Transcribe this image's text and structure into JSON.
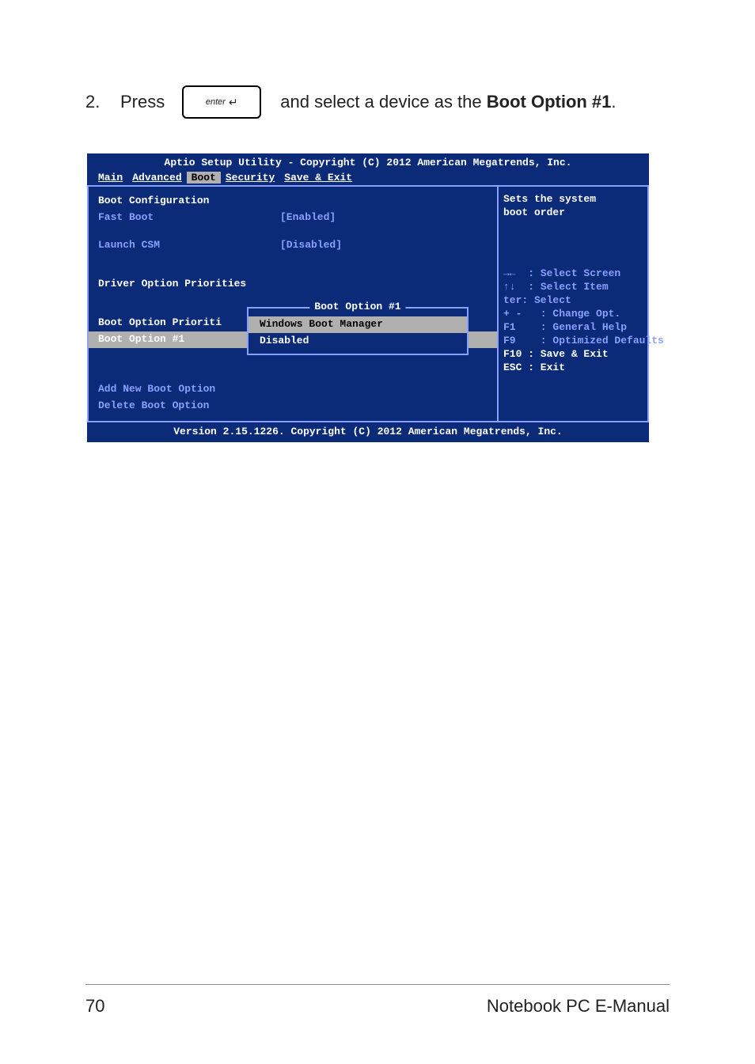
{
  "instruction": {
    "step": "2.",
    "prefix": "Press",
    "key_label": "enter",
    "suffix": " and select a device as the ",
    "bold": "Boot Option #1",
    "period": "."
  },
  "bios": {
    "header": "Aptio Setup Utility - Copyright (C) 2012 American Megatrends, Inc.",
    "tabs": [
      "Main",
      "Advanced",
      "Boot",
      "Security",
      "Save & Exit"
    ],
    "active_tab": "Boot",
    "left": {
      "config_title": "Boot Configuration",
      "fast_boot_label": "Fast Boot",
      "fast_boot_value": "[Enabled]",
      "launch_csm_label": "Launch CSM",
      "launch_csm_value": "[Disabled]",
      "driver_priorities": "Driver Option Priorities",
      "boot_prio_label": "Boot Option Prioriti",
      "boot1_label": "Boot Option #1",
      "add_new": "Add New Boot Option",
      "delete": "Delete Boot Option"
    },
    "popup": {
      "title": "Boot Option #1",
      "items": [
        "Windows Boot Manager",
        "Disabled"
      ],
      "selected_index": 0
    },
    "right": {
      "sets": "Sets the system",
      "boot_order": "boot order",
      "select_screen": "  : Select Screen",
      "select_item": "  : Select Item",
      "enter_select": "ter: Select",
      "change_opt": "   : Change Opt.",
      "general_help": "   : General Help",
      "opt_def": "   : Optimized Defaults",
      "f10": "F10 : Save & Exit",
      "esc": "ESC : Exit"
    },
    "footer": "Version 2.15.1226. Copyright (C) 2012 American Megatrends, Inc."
  },
  "page_footer": {
    "page_num": "70",
    "title": "Notebook PC E-Manual"
  }
}
